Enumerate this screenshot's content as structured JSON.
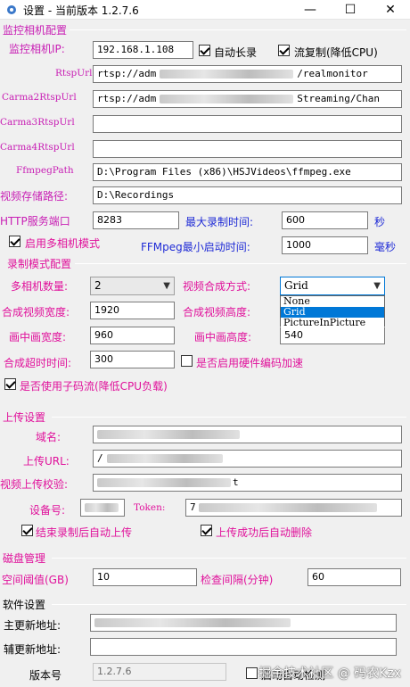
{
  "window": {
    "title": "设置 - 当前版本 1.2.7.6",
    "minimize": "—",
    "maximize": "☐",
    "close": "✕"
  },
  "camera": {
    "section": "监控相机配置",
    "ip_label": "监控相机IP:",
    "ip_value": "192.168.1.108",
    "auto_record": "自动长录",
    "stream_copy": "流复制(降低CPU)",
    "rtsp_label": "RtspUrl",
    "rtsp_prefix": "rtsp://adm",
    "rtsp_suffix": "/realmonitor",
    "cam2_label": "Carma2RtspUrl",
    "cam2_prefix": "rtsp://adm",
    "cam2_suffix": "Streaming/Chan",
    "cam3_label": "Carma3RtspUrl",
    "cam3_value": "",
    "cam4_label": "Carma4RtspUrl",
    "cam4_value": "",
    "ffmpeg_label": "FfmpegPath",
    "ffmpeg_value": "D:\\Program Files (x86)\\HSJVideos\\ffmpeg.exe",
    "storage_label": "视频存储路径:",
    "storage_value": "D:\\Recordings",
    "http_label": "HTTP服务端口",
    "http_value": "8283",
    "maxrec_label": "最大录制时间:",
    "maxrec_value": "600",
    "maxrec_unit": "秒",
    "multi_mode": "启用多相机模式",
    "ffmin_label": "FFMpeg最小启动时间:",
    "ffmin_value": "1000",
    "ffmin_unit": "毫秒"
  },
  "record": {
    "section": "录制模式配置",
    "count_label": "多相机数量:",
    "count_value": "2",
    "compose_label": "视频合成方式:",
    "compose_value": "Grid",
    "compose_options": [
      "None",
      "Grid",
      "PictureInPicture"
    ],
    "width_label": "合成视频宽度:",
    "width_value": "1920",
    "height_label": "合成视频高度:",
    "pip_w_label": "画中画宽度:",
    "pip_w_value": "960",
    "pip_h_label": "画中画高度:",
    "pip_h_value": "540",
    "timeout_label": "合成超时时间:",
    "timeout_value": "300",
    "hw_accel": "是否启用硬件编码加速",
    "sub_stream": "是否使用子码流(降低CPU负载)"
  },
  "upload": {
    "section": "上传设置",
    "domain_label": "域名:",
    "url_label": "上传URL:",
    "url_prefix": "/",
    "verify_label": "视频上传校验:",
    "verify_suffix": "t",
    "device_label": "设备号:",
    "token_label": "Token:",
    "token_prefix": "7",
    "auto_upload": "结束录制后自动上传",
    "auto_delete": "上传成功后自动删除"
  },
  "disk": {
    "section": "磁盘管理",
    "threshold_label": "空间阈值(GB)",
    "threshold_value": "10",
    "interval_label": "检查间隔(分钟)",
    "interval_value": "60"
  },
  "software": {
    "section": "软件设置",
    "main_update_label": "主更新地址:",
    "backup_update_label": "辅更新地址:",
    "version_label": "版本号",
    "version_value": "1.2.7.6",
    "startup_check": "启动自动检测"
  },
  "watermark": "掘金技术社区 @ 码农Kzx"
}
